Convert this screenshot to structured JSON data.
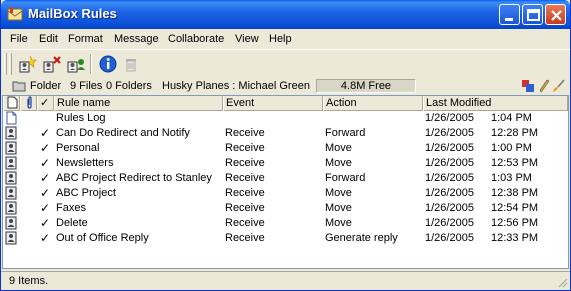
{
  "window": {
    "title": "MailBox Rules"
  },
  "menu": [
    "File",
    "Edit",
    "Format",
    "Message",
    "Collaborate",
    "View",
    "Help"
  ],
  "toolbar": {
    "buttons": [
      "new-rule-icon",
      "edit-rule-icon",
      "delete-rule-user-icon",
      "info-icon",
      "trash-icon"
    ]
  },
  "infobar": {
    "folder": "Folder",
    "files": "9 Files",
    "folders": "0 Folders",
    "path": "Husky Planes : Michael Green",
    "free": "4.8M Free"
  },
  "columns": {
    "name": "Rule name",
    "event": "Event",
    "action": "Action",
    "modified": "Last Modified"
  },
  "rows": [
    {
      "icon": "document-icon",
      "checked": false,
      "name": "Rules Log",
      "event": "",
      "action": "",
      "date": "1/26/2005",
      "time": "1:04 PM"
    },
    {
      "icon": "rule-icon",
      "checked": true,
      "name": "Can Do Redirect and Notify",
      "event": "Receive",
      "action": "Forward",
      "date": "1/26/2005",
      "time": "12:28 PM"
    },
    {
      "icon": "rule-icon",
      "checked": true,
      "name": "Personal",
      "event": "Receive",
      "action": "Move",
      "date": "1/26/2005",
      "time": "1:00 PM"
    },
    {
      "icon": "rule-icon",
      "checked": true,
      "name": "Newsletters",
      "event": "Receive",
      "action": "Move",
      "date": "1/26/2005",
      "time": "12:53 PM"
    },
    {
      "icon": "rule-icon",
      "checked": true,
      "name": "ABC Project Redirect to Stanley",
      "event": "Receive",
      "action": "Forward",
      "date": "1/26/2005",
      "time": "1:03 PM"
    },
    {
      "icon": "rule-icon",
      "checked": true,
      "name": "ABC Project",
      "event": "Receive",
      "action": "Move",
      "date": "1/26/2005",
      "time": "12:38 PM"
    },
    {
      "icon": "rule-icon",
      "checked": true,
      "name": "Faxes",
      "event": "Receive",
      "action": "Move",
      "date": "1/26/2005",
      "time": "12:54 PM"
    },
    {
      "icon": "rule-icon",
      "checked": true,
      "name": "Delete",
      "event": "Receive",
      "action": "Move",
      "date": "1/26/2005",
      "time": "12:56 PM"
    },
    {
      "icon": "rule-icon",
      "checked": true,
      "name": "Out of Office Reply",
      "event": "Receive",
      "action": "Generate reply",
      "date": "1/26/2005",
      "time": "12:33 PM"
    }
  ],
  "check_glyph": "✓",
  "status": {
    "text": "9 Items."
  }
}
